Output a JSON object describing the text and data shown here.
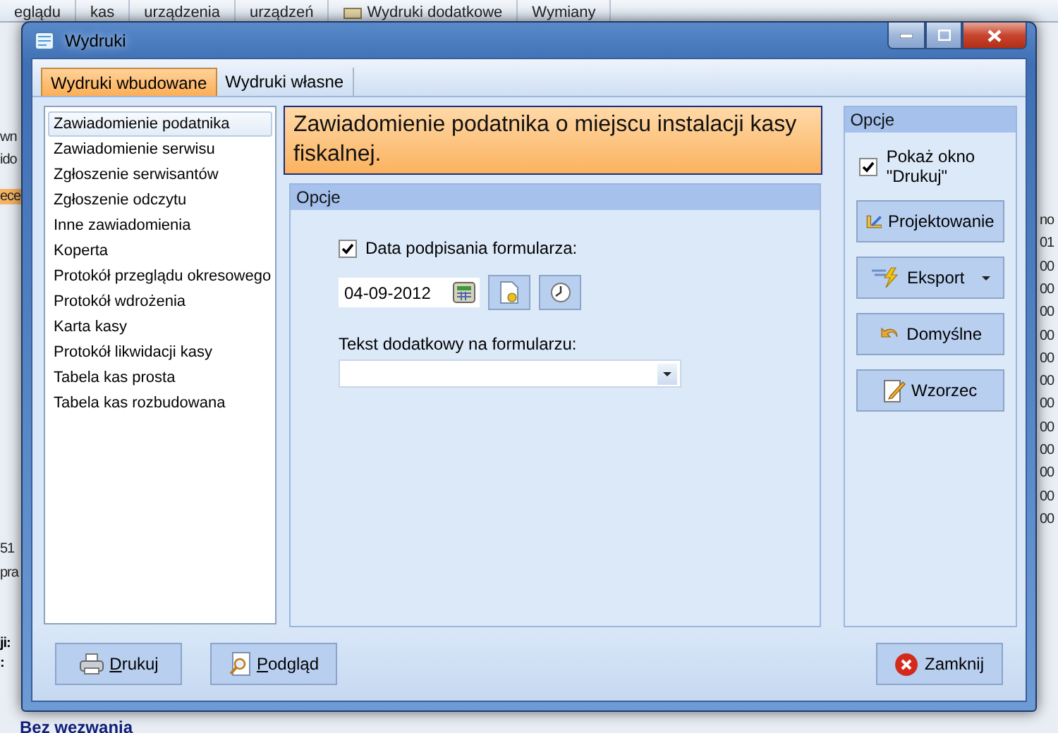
{
  "background": {
    "toolbar": [
      {
        "lines": [
          "eglądu"
        ],
        "kind": "text"
      },
      {
        "lines": [
          "kas"
        ],
        "kind": "text"
      },
      {
        "lines": [
          "urządzenia"
        ],
        "kind": "text"
      },
      {
        "lines": [
          "urządzeń"
        ],
        "kind": "text"
      },
      {
        "lines": [
          "Wydruki dodatkowe"
        ],
        "kind": "icon"
      },
      {
        "lines": [
          "Wymiany"
        ],
        "kind": "text"
      }
    ],
    "left_fragments": [
      {
        "text": "wn",
        "kind": "plain"
      },
      {
        "text": "ido",
        "kind": "plain"
      },
      {
        "text": "ece",
        "kind": "highlight"
      },
      {
        "text": "51",
        "kind": "plain"
      },
      {
        "text": "pra",
        "kind": "plain"
      },
      {
        "text": "ji:",
        "kind": "bold"
      },
      {
        "text": ":",
        "kind": "bold"
      }
    ],
    "right_fragments": [
      "no",
      "01",
      "00",
      "00",
      "00",
      "00",
      "00",
      "00",
      "00",
      "00",
      "00",
      "00",
      "00",
      "00"
    ],
    "footer_text": "Bez wezwania"
  },
  "dialog": {
    "title": "Wydruki",
    "tabs": [
      {
        "label": "Wydruki wbudowane",
        "selected": true
      },
      {
        "label": "Wydruki własne",
        "selected": false
      }
    ],
    "reports": [
      {
        "label": "Zawiadomienie podatnika",
        "selected": true
      },
      {
        "label": "Zawiadomienie serwisu",
        "selected": false
      },
      {
        "label": "Zgłoszenie serwisantów",
        "selected": false
      },
      {
        "label": "Zgłoszenie odczytu",
        "selected": false
      },
      {
        "label": "Inne zawiadomienia",
        "selected": false
      },
      {
        "label": "Koperta",
        "selected": false
      },
      {
        "label": "Protokół przeglądu okresowego",
        "selected": false
      },
      {
        "label": "Protokół wdrożenia",
        "selected": false
      },
      {
        "label": "Karta kasy",
        "selected": false
      },
      {
        "label": "Protokół likwidacji kasy",
        "selected": false
      },
      {
        "label": "Tabela kas prosta",
        "selected": false
      },
      {
        "label": "Tabela kas rozbudowana",
        "selected": false
      }
    ],
    "header": "Zawiadomienie podatnika o miejscu instalacji kasy fiskalnej.",
    "options": {
      "title": "Opcje",
      "date_label": "Data podpisania formularza:",
      "date_checked": true,
      "date": "04-09-2012",
      "extra_label": "Tekst dodatkowy na formularzu:"
    },
    "side": {
      "title": "Opcje",
      "show_print_label": "Pokaż okno \"Drukuj\"",
      "show_print_checked": true,
      "buttons": [
        {
          "label": "Projektowanie",
          "kind": "design",
          "dropdown": false
        },
        {
          "label": "Eksport",
          "kind": "export",
          "dropdown": true
        },
        {
          "label": "Domyślne",
          "kind": "reset",
          "dropdown": false
        },
        {
          "label": "Wzorzec",
          "kind": "template",
          "dropdown": false
        }
      ]
    },
    "footer": [
      {
        "label": "Drukuj",
        "kind": "print",
        "underline_first": true
      },
      {
        "label": "Podgląd",
        "kind": "preview",
        "underline_first": true
      },
      {
        "label": "Zamknij",
        "kind": "close",
        "underline_first": false
      }
    ]
  }
}
